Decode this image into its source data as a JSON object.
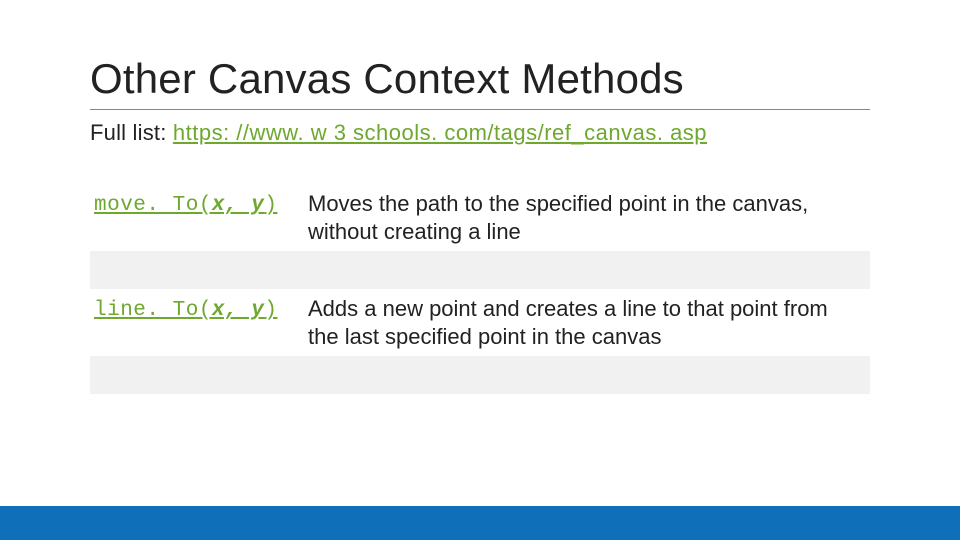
{
  "title": "Other Canvas Context Methods",
  "subtitle_label": "Full list: ",
  "subtitle_link": "https: //www. w 3 schools. com/tags/ref_canvas. asp",
  "table": {
    "rows": [
      {
        "method_prefix": "move. To(",
        "method_args": "x, y",
        "method_suffix": ")",
        "description": "Moves the path to the specified point in the canvas, without creating a line"
      },
      {
        "method_prefix": "line. To(",
        "method_args": "x, y",
        "method_suffix": ")",
        "description": "Adds a new point and creates a line to that point from the last specified point in the canvas"
      }
    ]
  },
  "colors": {
    "accent_green": "#6ea82f",
    "footer_blue": "#0f6fb8"
  }
}
